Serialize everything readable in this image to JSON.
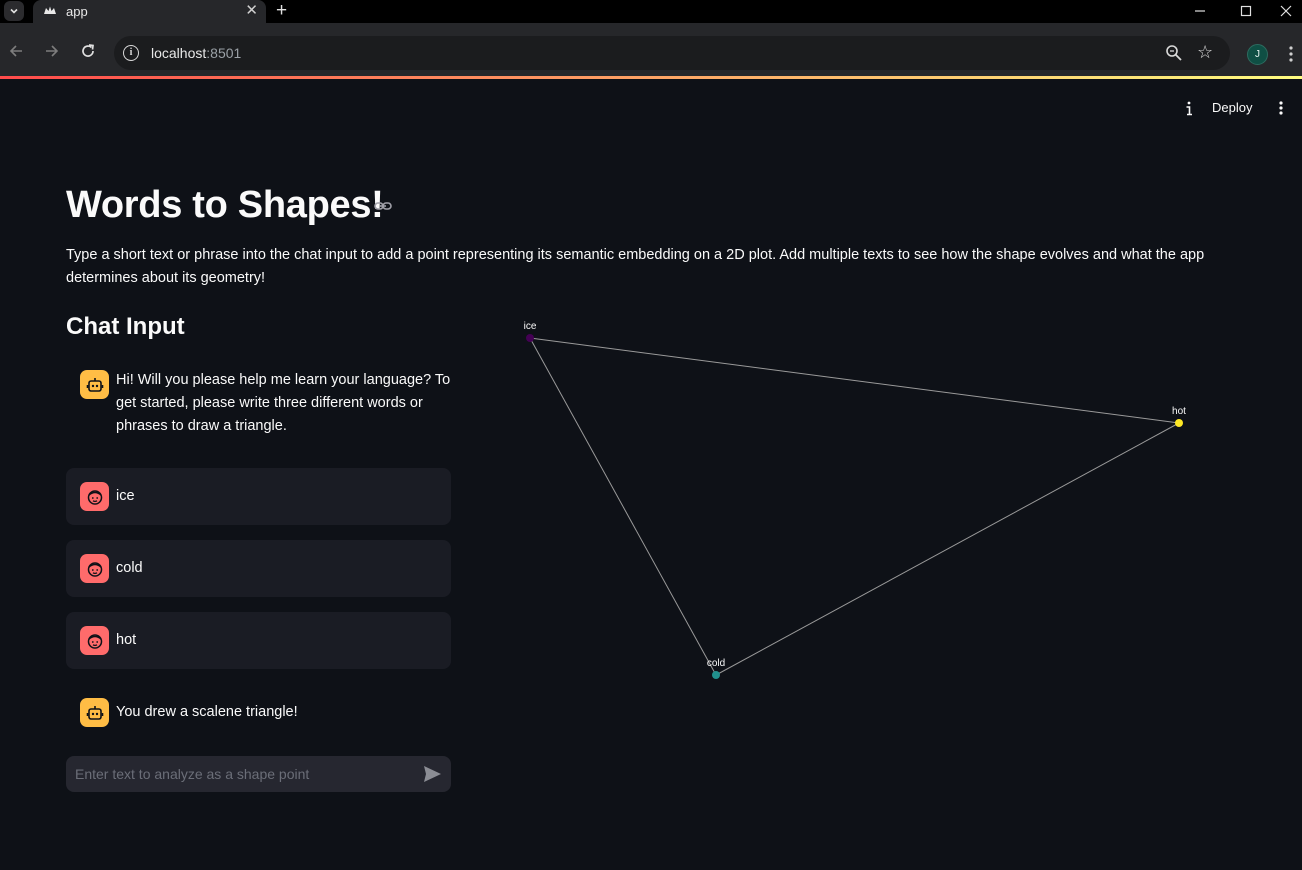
{
  "browser": {
    "tab_title": "app",
    "url_host": "localhost",
    "url_port": ":8501",
    "profile_initial": "J"
  },
  "header": {
    "deploy_label": "Deploy"
  },
  "main": {
    "title": "Words to Shapes!",
    "intro": "Type a short text or phrase into the chat input to add a point representing its semantic embedding on a 2D plot. Add multiple texts to see how the shape evolves and what the app determines about its geometry!",
    "chat_heading": "Chat Input",
    "messages": [
      {
        "role": "assistant",
        "text": "Hi! Will you please help me learn your language? To get started, please write three different words or phrases to draw a triangle."
      },
      {
        "role": "user",
        "text": "ice"
      },
      {
        "role": "user",
        "text": "cold"
      },
      {
        "role": "user",
        "text": "hot"
      },
      {
        "role": "assistant",
        "text": "You drew a scalene triangle!"
      }
    ],
    "input_placeholder": "Enter text to analyze as a shape point"
  },
  "chart_data": {
    "type": "scatter",
    "points": [
      {
        "label": "ice",
        "color": "#440154"
      },
      {
        "label": "hot",
        "color": "#fde725"
      },
      {
        "label": "cold",
        "color": "#21908d"
      }
    ],
    "line_color": "#9a9a9a",
    "axes_visible": false,
    "grid": false
  }
}
